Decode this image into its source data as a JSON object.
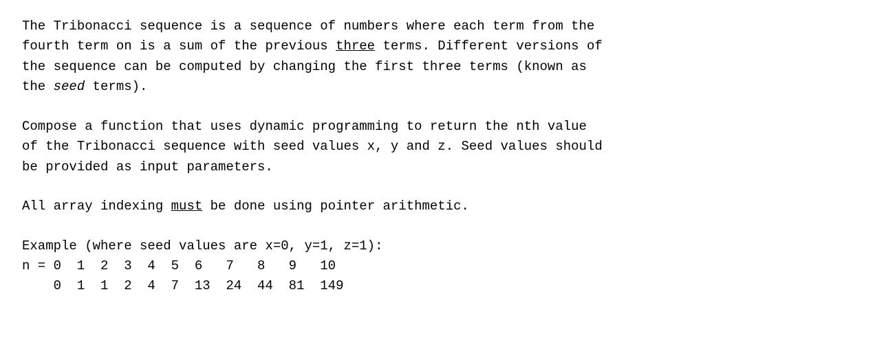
{
  "p1": {
    "t1": "The Tribonacci sequence is a sequence of numbers where each term from the\nfourth term on is a sum of the previous ",
    "u1": "three",
    "t2": " terms. Different versions of\nthe sequence can be computed by changing the first three terms (known as\nthe ",
    "i1": "seed",
    "t3": " terms)."
  },
  "p2": {
    "t1": "Compose a function that uses dynamic programming to return the nth value\nof the Tribonacci sequence with seed values x, y and z. Seed values should\nbe provided as input parameters."
  },
  "p3": {
    "t1": "All array indexing ",
    "u1": "must",
    "t2": " be done using pointer arithmetic."
  },
  "p4": {
    "t1": "Example (where seed values are x=0, y=1, z=1):"
  },
  "table": {
    "header": "n = 0  1  2  3  4  5  6   7   8   9   10",
    "values": "    0  1  1  2  4  7  13  24  44  81  149"
  }
}
